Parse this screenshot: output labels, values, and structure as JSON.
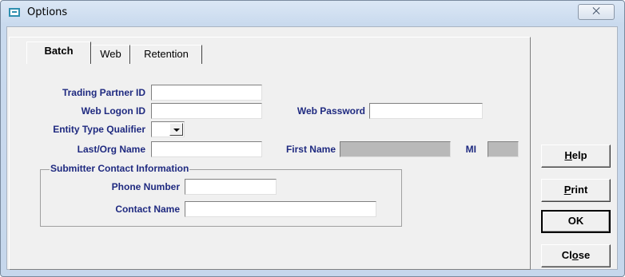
{
  "window": {
    "title": "Options",
    "close_glyph": "⨉"
  },
  "tabs": [
    {
      "label": "Batch",
      "active": true
    },
    {
      "label": "Web",
      "active": false
    },
    {
      "label": "Retention",
      "active": false
    }
  ],
  "form": {
    "trading_partner_id": {
      "label": "Trading Partner ID",
      "value": ""
    },
    "web_logon_id": {
      "label": "Web Logon ID",
      "value": ""
    },
    "web_password": {
      "label": "Web Password",
      "value": ""
    },
    "entity_type_qualifier": {
      "label": "Entity Type Qualifier",
      "value": ""
    },
    "last_org_name": {
      "label": "Last/Org Name",
      "value": ""
    },
    "first_name": {
      "label": "First Name",
      "value": "",
      "disabled": true
    },
    "mi": {
      "label": "MI",
      "value": "",
      "disabled": true
    }
  },
  "submitter_contact": {
    "title": "Submitter Contact Information",
    "phone_number": {
      "label": "Phone Number",
      "value": ""
    },
    "contact_name": {
      "label": "Contact Name",
      "value": ""
    }
  },
  "buttons": {
    "help": {
      "pre": "",
      "mnemonic": "H",
      "post": "elp"
    },
    "print": {
      "pre": "",
      "mnemonic": "P",
      "post": "rint"
    },
    "ok": {
      "label": "OK"
    },
    "close": {
      "pre": "Cl",
      "mnemonic": "o",
      "post": "se"
    }
  },
  "colors": {
    "label_text": "#1f2a80",
    "disabled_field": "#b9b9b9",
    "dialog_face": "#f0f0f0",
    "frame": "#c6d7ec"
  }
}
